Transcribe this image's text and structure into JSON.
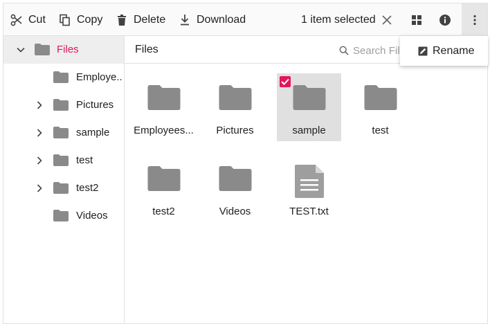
{
  "toolbar": {
    "cut_label": "Cut",
    "copy_label": "Copy",
    "delete_label": "Delete",
    "download_label": "Download",
    "selection_status": "1 item selected",
    "icons": [
      "scissors-icon",
      "copy-icon",
      "trash-icon",
      "download-icon",
      "close-icon",
      "grid-view-icon",
      "info-icon",
      "more-vertical-icon"
    ]
  },
  "navigation": {
    "root": {
      "label": "Files",
      "expanded": true
    },
    "items": [
      {
        "label": "Employees",
        "display": "Employe...",
        "has_children": false
      },
      {
        "label": "Pictures",
        "has_children": true
      },
      {
        "label": "sample",
        "has_children": true
      },
      {
        "label": "test",
        "has_children": true
      },
      {
        "label": "test2",
        "has_children": true
      },
      {
        "label": "Videos",
        "has_children": false
      }
    ]
  },
  "address_bar": {
    "breadcrumb": "Files",
    "search_placeholder": "Search Files"
  },
  "files": [
    {
      "name": "Employees...",
      "type": "folder",
      "selected": false
    },
    {
      "name": "Pictures",
      "type": "folder",
      "selected": false
    },
    {
      "name": "sample",
      "type": "folder",
      "selected": true
    },
    {
      "name": "test",
      "type": "folder",
      "selected": false
    },
    {
      "name": "test2",
      "type": "folder",
      "selected": false
    },
    {
      "name": "Videos",
      "type": "folder",
      "selected": false
    },
    {
      "name": "TEST.txt",
      "type": "file",
      "selected": false
    }
  ],
  "context_menu": {
    "items": [
      {
        "label": "Rename",
        "icon": "rename-icon"
      }
    ]
  },
  "colors": {
    "accent": "#e3165b",
    "folder": "#8a8a8a",
    "selected_tile": "#e0e0e0",
    "toolbar_bg": "#fafafa"
  }
}
